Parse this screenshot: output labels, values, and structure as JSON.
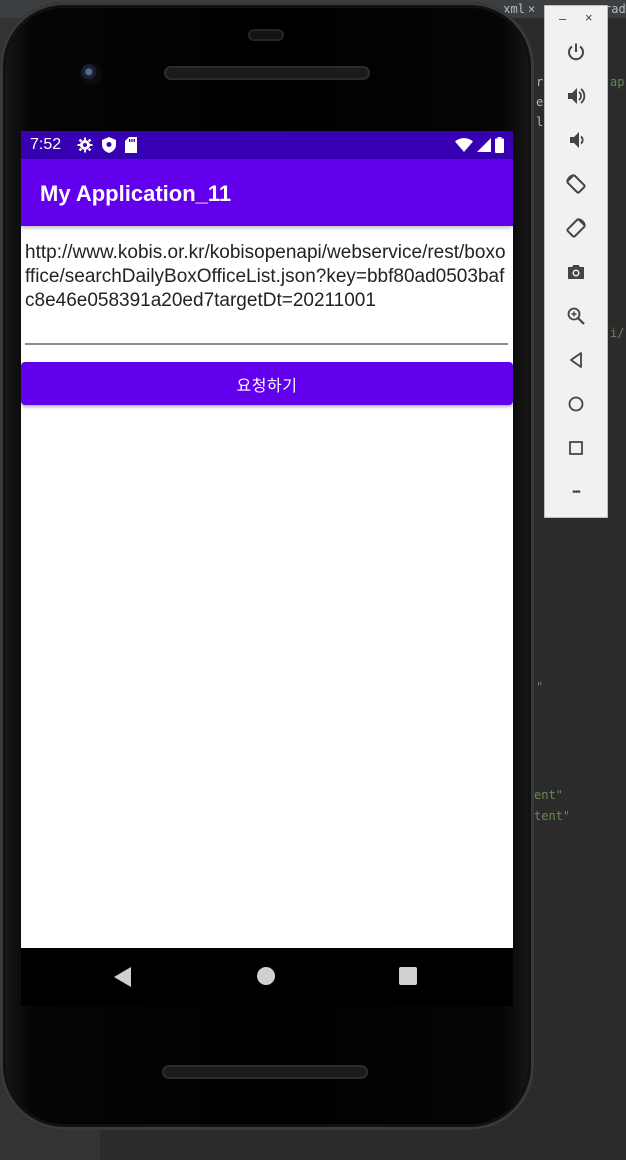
{
  "ide": {
    "tab_label": "_xml",
    "tab_label2": "rad",
    "code_lines": [
      "ent\"",
      "tent\""
    ],
    "snippet_a": "r",
    "snippet_b": "e",
    "snippet_c": "l",
    "snippet_d": "ap",
    "snippet_e": "i/",
    "snippet_f": "\""
  },
  "status_bar": {
    "time": "7:52"
  },
  "app_bar": {
    "title": "My Application_11"
  },
  "url_input": {
    "value": "http://www.kobis.or.kr/kobisopenapi/webservice/rest/boxoffice/searchDailyBoxOfficeList.json?key=bbf80ad0503bafc8e46e058391a20ed7targetDt=20211001"
  },
  "request_button": {
    "label": "요청하기"
  },
  "toolbar": {
    "minimize_label": "–",
    "close_label": "×",
    "more_label": "•••"
  },
  "colors": {
    "status_bar": "#3700b3",
    "app_bar": "#6200ee",
    "button": "#6200ee"
  }
}
